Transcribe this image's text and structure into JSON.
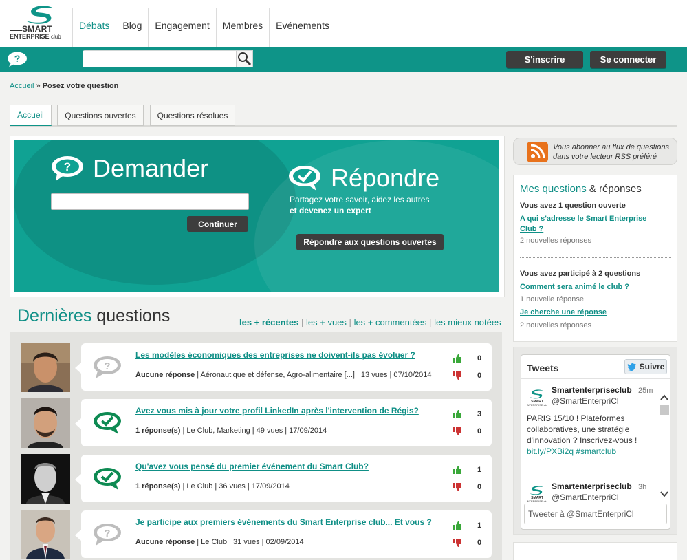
{
  "logo": {
    "line1": "SMART",
    "line2": "ENTERPRISE",
    "line2_suffix": "club"
  },
  "nav": [
    {
      "label": "Débats",
      "active": true
    },
    {
      "label": "Blog"
    },
    {
      "label": "Engagement"
    },
    {
      "label": "Membres"
    },
    {
      "label": "Evénements"
    }
  ],
  "topbar": {
    "search_value": "",
    "signup_label": "S'inscrire",
    "login_label": "Se connecter"
  },
  "breadcrumb": {
    "home": "Accueil",
    "separator": "»",
    "current": "Posez votre question"
  },
  "tabs": [
    {
      "label": "Accueil",
      "active": true
    },
    {
      "label": "Questions ouvertes"
    },
    {
      "label": "Questions résolues"
    }
  ],
  "hero": {
    "ask_title": "Demander",
    "ask_input_value": "",
    "continue_label": "Continuer",
    "answer_title": "Répondre",
    "answer_sub1": "Partagez votre savoir, aidez les autres",
    "answer_sub2": "et devenez un expert",
    "answer_button": "Répondre aux questions ouvertes"
  },
  "latest": {
    "title_part1": "Dernières",
    "title_part2": "questions",
    "sort_links": [
      "les + récentes",
      "les + vues",
      "les + commentées",
      "les mieux notées"
    ],
    "sort_separator": "|"
  },
  "questions": [
    {
      "title": "Les modèles économiques des entreprises ne doivent-ils pas évoluer ?",
      "answers": "Aucune réponse",
      "meta": " | Aéronautique et défense, Agro-alimentaire [...] | 13 vues | 07/10/2014",
      "likes": "0",
      "dislikes": "0",
      "answered": false
    },
    {
      "title": "Avez vous mis à jour votre profil LinkedIn après l'intervention de Régis?",
      "answers": "1 réponse(s)",
      "meta": " | Le Club, Marketing | 49 vues | 17/09/2014",
      "likes": "3",
      "dislikes": "0",
      "answered": true
    },
    {
      "title": "Qu'avez vous pensé du premier événement du Smart Club?",
      "answers": "1 réponse(s)",
      "meta": " | Le Club | 36 vues | 17/09/2014",
      "likes": "1",
      "dislikes": "0",
      "answered": true
    },
    {
      "title": "Je participe aux premiers événements du Smart Enterprise club... Et vous ?",
      "answers": "Aucune réponse",
      "meta": " | Le Club | 31 vues | 02/09/2014",
      "likes": "1",
      "dislikes": "0",
      "answered": false
    }
  ],
  "rss": {
    "line1": "Vous abonner au flux de questions",
    "line2": "dans votre lecteur RSS préféré"
  },
  "my_questions": {
    "title_part1": "Mes questions",
    "title_part2": "& réponses",
    "open_count_text": "Vous avez 1 question ouverte",
    "open_link_line1": "A qui s'adresse le Smart Enterprise",
    "open_link_line2": "Club ?",
    "open_replies": "2 nouvelles réponses",
    "participated_text": "Vous avez participé à 2 questions",
    "part_link1": "Comment sera animé le club ?",
    "part_replies1": "1 nouvelle réponse",
    "part_link2": "Je cherche une réponse",
    "part_replies2": "2 nouvelles réponses"
  },
  "tweets": {
    "header": "Tweets",
    "follow_label": "Suivre",
    "items": [
      {
        "name": "Smartenterpriseclub",
        "handle": "@SmartEnterpriCl",
        "time": "25m",
        "text_lines": [
          "PARIS 15/10 ! Plateformes",
          "collaboratives, une stratégie",
          "d'innovation ? Inscrivez-vous !"
        ],
        "link": "bit.ly/PXBi2q #smartclub"
      },
      {
        "name": "Smartenterpriseclub",
        "handle": "@SmartEnterpriCl",
        "time": "3h"
      }
    ],
    "compose_placeholder": "Tweeter à @SmartEnterpriCl"
  },
  "colors": {
    "teal": "#0e9488",
    "dark_button": "#3d3d3d",
    "rss_orange": "#e8721c",
    "vote_green": "#3aa83a",
    "vote_red": "#cc3333"
  }
}
